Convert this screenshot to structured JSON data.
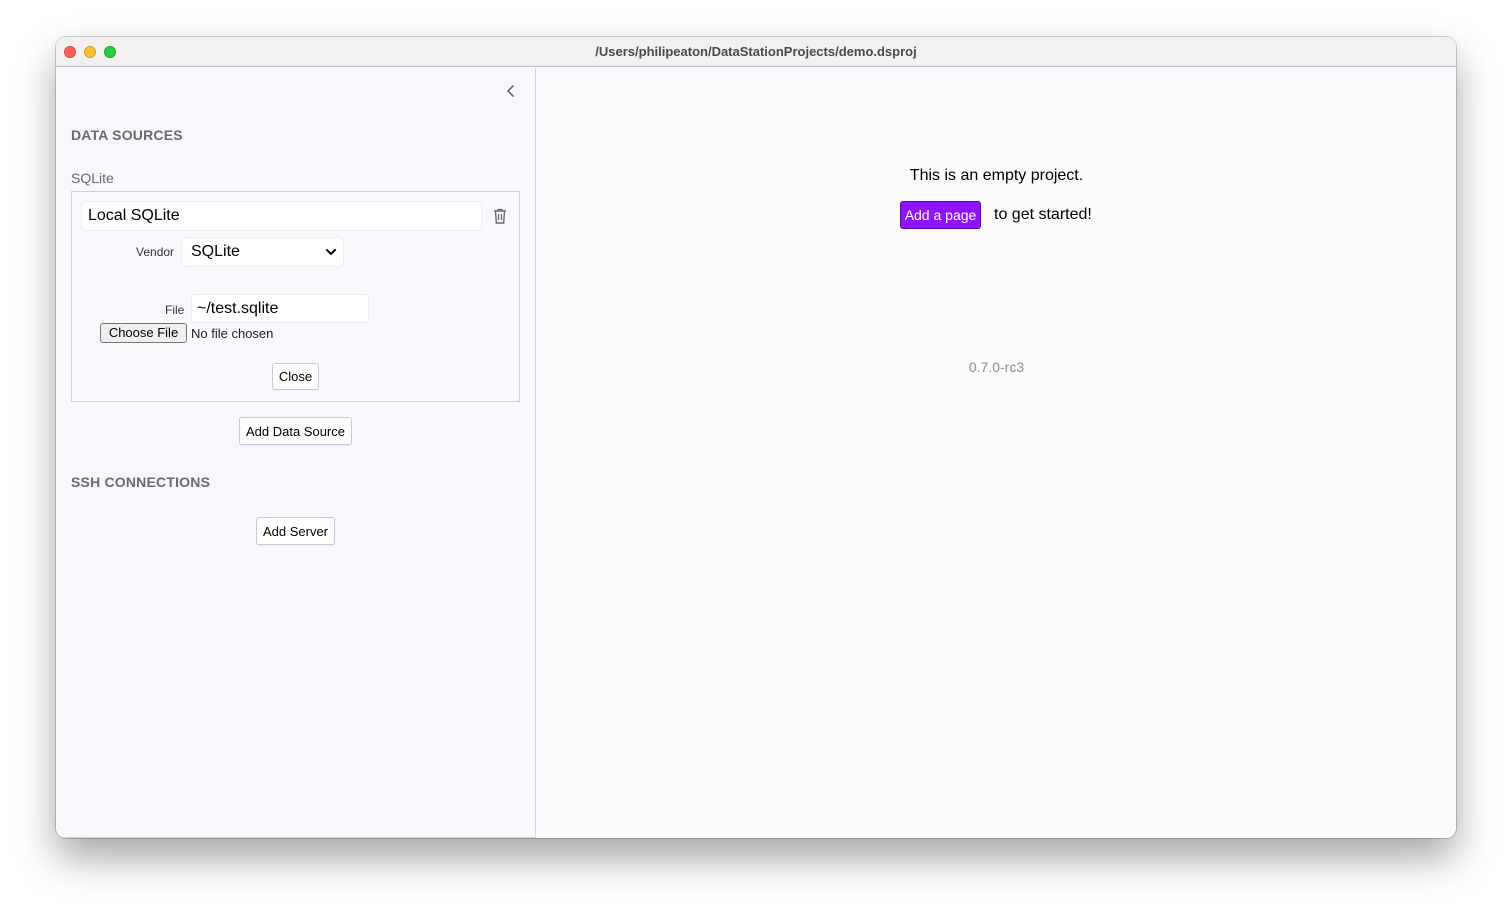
{
  "window": {
    "title": "/Users/philipeaton/DataStationProjects/demo.dsproj",
    "controls": [
      "close",
      "minimize",
      "maximize"
    ]
  },
  "sidebar": {
    "collapse_icon": "chevron-left-icon",
    "data_sources": {
      "title": "DATA SOURCES",
      "items": [
        {
          "type_label": "SQLite",
          "name": "Local SQLite",
          "delete_icon": "trash-icon",
          "vendor_label": "Vendor",
          "vendor_value": "SQLite",
          "file_label": "File",
          "file_value": "~/test.sqlite",
          "choose_file_label": "Choose File",
          "no_file_text": "No file chosen",
          "close_label": "Close"
        }
      ],
      "add_label": "Add Data Source"
    },
    "ssh": {
      "title": "SSH CONNECTIONS",
      "add_label": "Add Server"
    }
  },
  "main": {
    "empty_text": "This is an empty project.",
    "add_page_label": "Add a page",
    "get_started_text": "to get started!",
    "version": "0.7.0-rc3"
  },
  "colors": {
    "accent": "#9013fe",
    "sidebar_bg": "#f7f7fc",
    "main_bg": "#fbfbfe",
    "section_title": "#6b6b6b"
  }
}
